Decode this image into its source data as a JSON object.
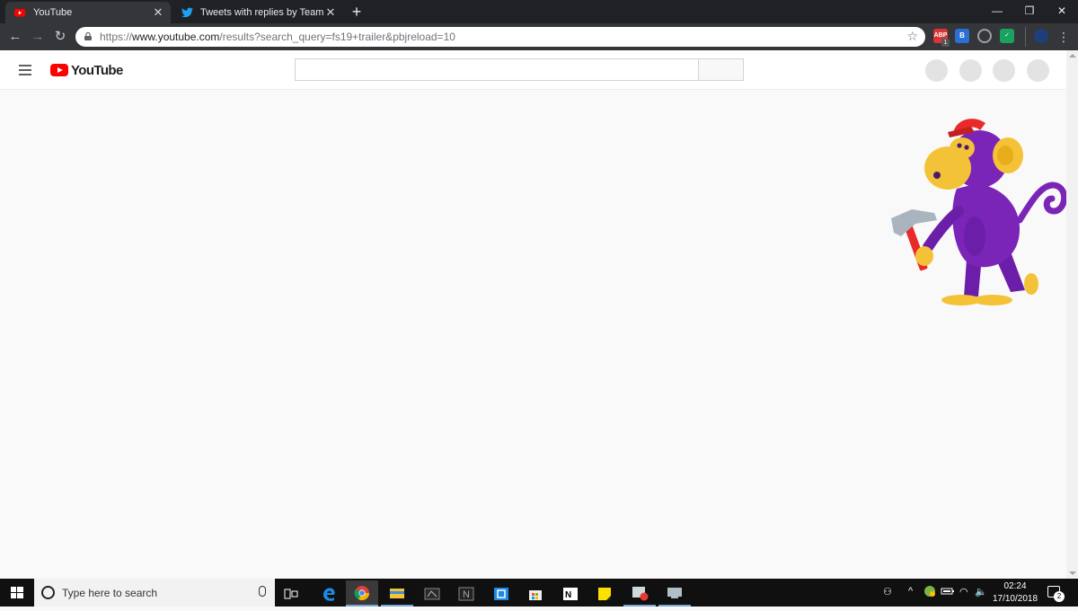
{
  "browser": {
    "tabs": [
      {
        "label": "YouTube",
        "active": true,
        "icon": "youtube-favicon"
      },
      {
        "label": "Tweets with replies by Team You",
        "active": false,
        "icon": "twitter-favicon"
      }
    ],
    "new_tab_label": "+",
    "address": {
      "scheme": "https://",
      "host": "www.youtube.com",
      "path": "/results?search_query=fs19+trailer&pbjreload=10"
    },
    "extensions": [
      {
        "name": "adblock-plus",
        "label": "ABP",
        "badge": "1",
        "color": "#d83535"
      },
      {
        "name": "extension-blue",
        "label": "B",
        "color": "#2a6fd6"
      },
      {
        "name": "extension-grey",
        "label": "",
        "color": "#5f6368"
      },
      {
        "name": "extension-green",
        "label": "",
        "color": "#1aa260"
      },
      {
        "name": "extension-shield",
        "label": "",
        "color": "#1f3f7a"
      }
    ]
  },
  "youtube": {
    "logo_text": "YouTube",
    "search_placeholder": "",
    "placeholder_avatars": 4,
    "illustration": "monkey-with-hammer"
  },
  "taskbar": {
    "search_placeholder": "Type here to search",
    "apps": [
      "task-view",
      "edge",
      "chrome",
      "file-explorer",
      "nvidia",
      "notion",
      "vpn",
      "store",
      "newsflow",
      "sticky-notes",
      "photos",
      "remote-desktop"
    ],
    "clock_time": "02:24",
    "clock_date": "17/10/2018",
    "notification_count": "2"
  },
  "colors": {
    "chrome_dark": "#202124",
    "youtube_red": "#ff0000",
    "monkey_purple": "#6b1fa8",
    "monkey_yellow": "#f4c237"
  }
}
